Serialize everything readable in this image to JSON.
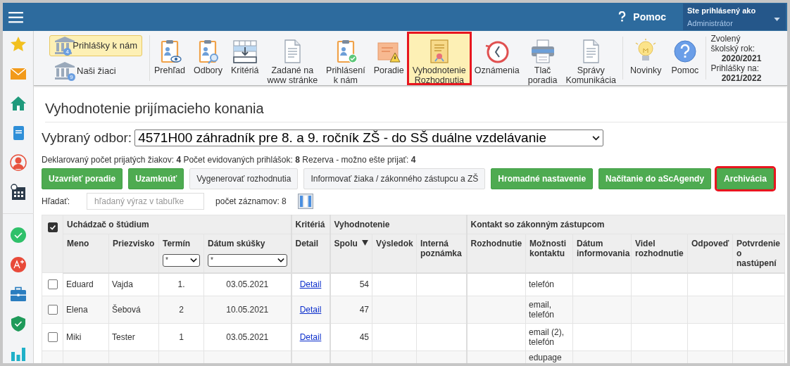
{
  "header": {
    "help": "Pomoc",
    "user_caption": "Ste prihlásený ako",
    "user_name": "Administrátor"
  },
  "toolbar": {
    "modules": [
      {
        "label": "Prihlášky k nám",
        "badge": "4",
        "selected": true
      },
      {
        "label": "Naši žiaci",
        "badge": "9",
        "selected": false
      }
    ],
    "items": [
      {
        "label": "Prehľad",
        "selected": false,
        "highlighted": false
      },
      {
        "label": "Odbory",
        "selected": false,
        "highlighted": false
      },
      {
        "label": "Kritériá",
        "selected": false,
        "highlighted": false
      },
      {
        "label": "Zadané na\nwww stránke",
        "selected": false,
        "highlighted": false
      },
      {
        "label": "Prihlásení\nk nám",
        "selected": false,
        "highlighted": false
      },
      {
        "label": "Poradie",
        "selected": false,
        "highlighted": false
      },
      {
        "label": "Vyhodnotenie\nRozhodnutia",
        "selected": true,
        "highlighted": true
      },
      {
        "label": "Oznámenia",
        "selected": false,
        "highlighted": false
      },
      {
        "label": "Tlač\nporadia",
        "selected": false,
        "highlighted": false
      },
      {
        "label": "Správy\nKomunikácia",
        "selected": false,
        "highlighted": false
      }
    ],
    "extras": [
      {
        "label": "Novinky"
      },
      {
        "label": "Pomoc"
      }
    ],
    "year_info": [
      {
        "label": "Zvolený školský rok:",
        "value": "2020/2021"
      },
      {
        "label": "Prihlášky na:",
        "value": "2021/2022"
      }
    ]
  },
  "title": "Vyhodnotenie prijímacieho konania",
  "branch_select": {
    "label": "Vybraný odbor:",
    "value": "4571H00 záhradník pre 8. a 9. ročník ZŠ - do SŠ duálne vzdelávanie"
  },
  "summary": "Deklarovaný počet prijatých žiakov: **4** Počet evidovaných prihlášok: **8** Rezerva - možno ešte prijať: **4**",
  "actions": [
    {
      "label": "Uzavrieť poradie",
      "kind": "success",
      "highlighted": false
    },
    {
      "label": "Uzamknúť",
      "kind": "success",
      "highlighted": false
    },
    {
      "label": "Vygenerovať rozhodnutia",
      "kind": "light",
      "highlighted": false
    },
    {
      "label": "Informovať žiaka / zákonného zástupcu a ZŠ",
      "kind": "light",
      "highlighted": false
    },
    {
      "label": "Hromadné nastavenie",
      "kind": "success",
      "highlighted": false
    },
    {
      "label": "Načítanie do aScAgendy",
      "kind": "success",
      "highlighted": false
    },
    {
      "label": "Archivácia",
      "kind": "success",
      "highlighted": true
    }
  ],
  "search": {
    "label": "Hľadať:",
    "placeholder": "hľadaný výraz v tabuľke",
    "count": "počet záznamov: 8"
  },
  "table": {
    "select_all": {
      "checked": true
    },
    "groups": [
      {
        "label": "Uchádzač o štúdium",
        "columns": [
          {
            "label": "Meno"
          },
          {
            "label": "Priezvisko"
          },
          {
            "label": "Termín",
            "filter": "*"
          },
          {
            "label": "Dátum skúšky",
            "filter": "*"
          }
        ]
      },
      {
        "label": "Kritériá",
        "columns": [
          {
            "label": "Detail"
          }
        ]
      },
      {
        "label": "Vyhodnotenie",
        "columns": [
          {
            "label": "Spolu",
            "sorted": true
          },
          {
            "label": "Výsledok"
          },
          {
            "label": "Interná poznámka"
          }
        ]
      },
      {
        "label": "Kontakt so zákonným zástupcom",
        "columns": [
          {
            "label": "Rozhodnutie"
          },
          {
            "label": "Možnosti kontaktu"
          },
          {
            "label": "Dátum informovania"
          },
          {
            "label": "Videl rozhodnutie"
          },
          {
            "label": "Odpoveď"
          },
          {
            "label": "Potvrdenie o nastúpení"
          }
        ]
      }
    ],
    "rows": [
      {
        "checked": false,
        "cells": [
          "Eduard",
          "Vajda",
          "1.",
          "03.05.2021",
          "Detail",
          "54",
          null,
          null,
          null,
          "telefón",
          null,
          null,
          null,
          null
        ]
      },
      {
        "checked": false,
        "cells": [
          "Elena",
          "Šebová",
          "2",
          "10.05.2021",
          "Detail",
          "47",
          null,
          null,
          null,
          "email,\ntelefón",
          null,
          null,
          null,
          null
        ]
      },
      {
        "checked": false,
        "cells": [
          "Miki",
          "Tester",
          "1",
          "03.05.2021",
          "Detail",
          "45",
          null,
          null,
          null,
          "email (2),\ntelefón",
          null,
          null,
          null,
          null
        ]
      },
      {
        "cells": [
          null,
          null,
          null,
          null,
          null,
          null,
          null,
          null,
          null,
          "edupage",
          null,
          null,
          null,
          null
        ]
      }
    ]
  }
}
